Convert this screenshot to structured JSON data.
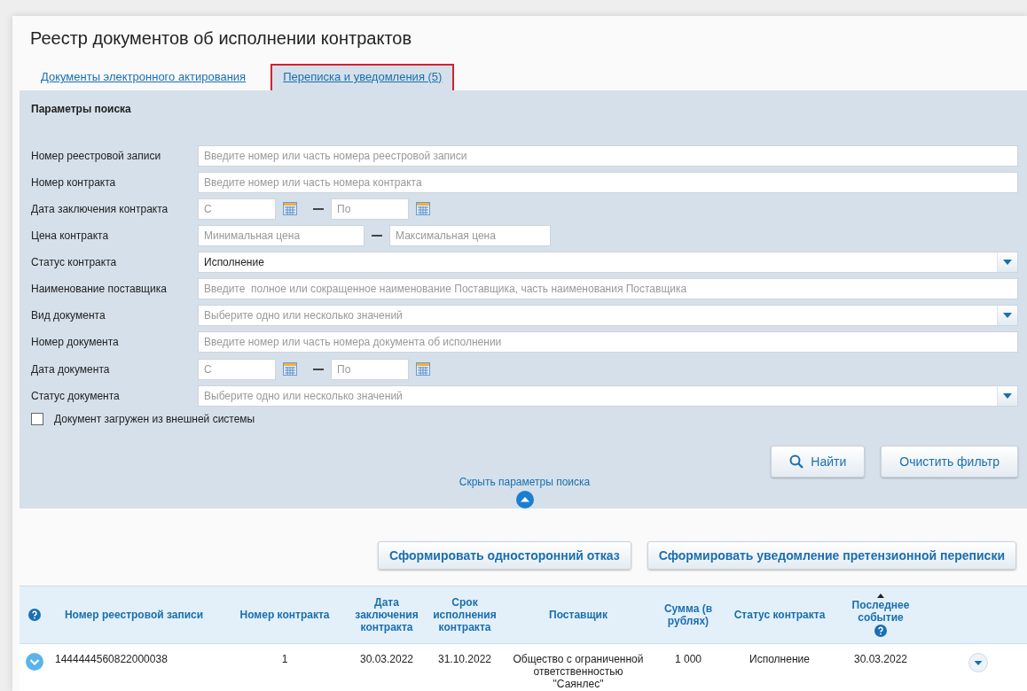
{
  "page_title": "Реестр документов об исполнении контрактов",
  "tabs": [
    {
      "label": "Документы электронного актирования",
      "selected": false
    },
    {
      "label": "Переписка и уведомления (5)",
      "selected": true
    }
  ],
  "search_panel": {
    "title": "Параметры поиска",
    "fields": [
      {
        "kind": "text",
        "label": "Номер реестровой записи",
        "placeholder": "Введите номер или часть номера реестровой записи"
      },
      {
        "kind": "text",
        "label": "Номер контракта",
        "placeholder": "Введите номер или часть номера контракта"
      },
      {
        "kind": "date_range",
        "label": "Дата заключения контракта",
        "from_placeholder": "С",
        "to_placeholder": "По"
      },
      {
        "kind": "range",
        "label": "Цена контракта",
        "from_placeholder": "Минимальная цена",
        "to_placeholder": "Максимальная цена"
      },
      {
        "kind": "select",
        "label": "Статус контракта",
        "value": "Исполнение"
      },
      {
        "kind": "text",
        "label": "Наименование поставщика",
        "placeholder": "Введите  полное или сокращенное наименование Поставщика, часть наименования Поставщика"
      },
      {
        "kind": "select",
        "label": "Вид документа",
        "placeholder": "Выберите одно или несколько значений"
      },
      {
        "kind": "text",
        "label": "Номер документа",
        "placeholder": "Введите номер или часть номера документа об исполнении"
      },
      {
        "kind": "date_range",
        "label": "Дата документа",
        "from_placeholder": "С",
        "to_placeholder": "По"
      },
      {
        "kind": "select",
        "label": "Статус документа",
        "placeholder": "Выберите одно или несколько значений"
      }
    ],
    "checkbox": {
      "label": "Документ загружен из внешней системы",
      "checked": false
    },
    "buttons": [
      "Найти",
      "Очистить фильтр"
    ],
    "toggle_link": "Скрыть параметры поиска"
  },
  "actions": [
    "Сформировать односторонний отказ",
    "Сформировать уведомление претензионной переписки"
  ],
  "table": {
    "columns": [
      {
        "help": true
      },
      {
        "label": "Номер реестровой записи"
      },
      {
        "label": "Номер контракта"
      },
      {
        "label": "Дата заключения контракта"
      },
      {
        "label": "Срок исполнения контракта"
      },
      {
        "label": "Поставщик"
      },
      {
        "label": "Сумма (в рублях)"
      },
      {
        "label": "Статус контракта"
      },
      {
        "label": "Последнее событие",
        "sorted": true,
        "help": true
      }
    ],
    "rows": [
      {
        "cells": [
          "",
          "1444444560822000038",
          "1",
          "30.03.2022",
          "31.10.2022",
          "Общество с ограниченной ответственностью \"Саянлес\"",
          "1 000",
          "Исполнение",
          "30.03.2022"
        ]
      }
    ]
  }
}
